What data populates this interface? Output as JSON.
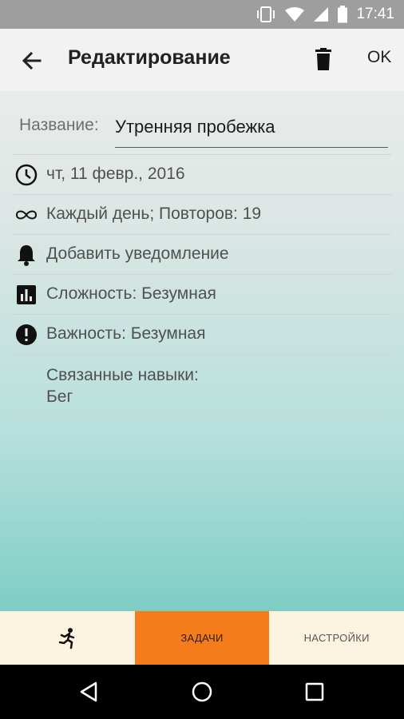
{
  "status_bar": {
    "time": "17:41"
  },
  "app_bar": {
    "title": "Редактирование",
    "ok_label": "OK"
  },
  "form": {
    "name_label": "Название:",
    "name_value": "Утренняя пробежка",
    "date": "чт, 11 февр., 2016",
    "repeat": "Каждый день; Повторов: 19",
    "reminder": "Добавить уведомление",
    "difficulty": "Сложность: Безумная",
    "importance": "Важность: Безумная",
    "linked_skills_label": "Связанные навыки:",
    "linked_skills_value": "Бег"
  },
  "bottom_nav": {
    "tabs": [
      {
        "icon": "running-man-icon",
        "label": ""
      },
      {
        "label": "ЗАДАЧИ",
        "active": true
      },
      {
        "label": "НАСТРОЙКИ"
      }
    ]
  },
  "colors": {
    "accent": "#f47c1a",
    "status_bar": "#9e9e9e",
    "bottom_nav_bg": "#fdf3e1"
  }
}
